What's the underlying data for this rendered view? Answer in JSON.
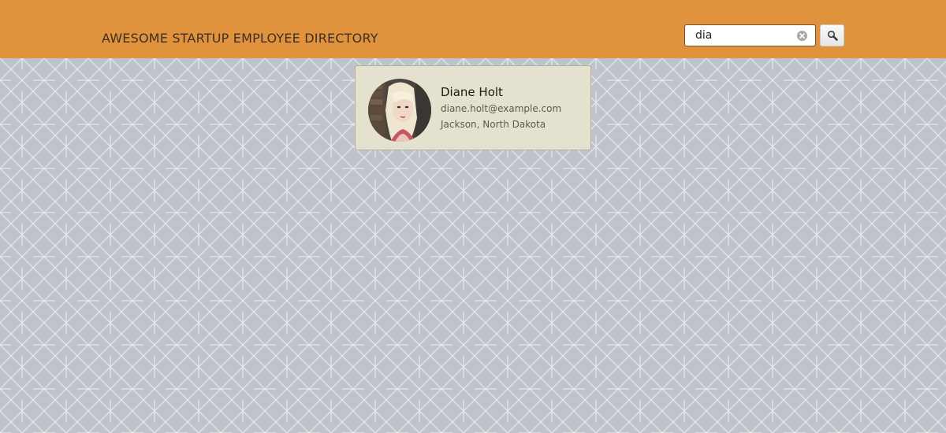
{
  "header": {
    "title": "AWESOME STARTUP EMPLOYEE DIRECTORY",
    "background_color": "#e1923d"
  },
  "search": {
    "value": "dia",
    "clear_icon": "clear-circle-icon",
    "button_icon": "magnifier-icon"
  },
  "results": [
    {
      "name": "Diane Holt",
      "email": "diane.holt@example.com",
      "location": "Jackson, North Dakota",
      "avatar": "portrait-photo"
    }
  ],
  "colors": {
    "card_background": "#e4e1cf",
    "page_background": "#bec4c9",
    "pattern_lines": "#e4e7ea"
  }
}
